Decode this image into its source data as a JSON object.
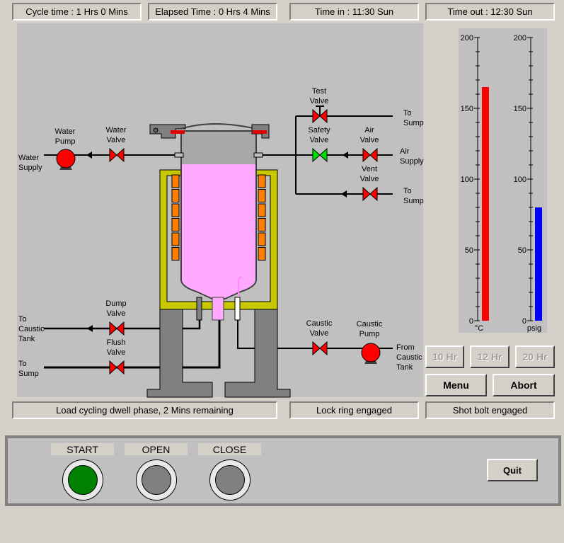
{
  "header": {
    "cycle_time": "Cycle time : 1 Hrs 0 Mins",
    "elapsed_time": "Elapsed Time : 0 Hrs 4 Mins",
    "time_in": "Time in : 11:30 Sun",
    "time_out": "Time out : 12:30 Sun"
  },
  "diagram": {
    "labels": {
      "water_supply": [
        "Water",
        "Supply"
      ],
      "water_pump": [
        "Water",
        "Pump"
      ],
      "to_sump_top": [
        "To",
        "Sump"
      ],
      "air_supply": [
        "Air",
        "Supply"
      ],
      "to_sump_mid": [
        "To",
        "Sump"
      ],
      "to_caustic_tank": [
        "To",
        "Caustic",
        "Tank"
      ],
      "to_sump_bottom": [
        "To",
        "Sump"
      ],
      "caustic_pump": [
        "Caustic",
        "Pump"
      ],
      "from_caustic_tank": [
        "From",
        "Caustic",
        "Tank"
      ]
    },
    "valves": [
      {
        "id": "water-valve",
        "label": [
          "Water",
          "Valve"
        ],
        "state": "closed"
      },
      {
        "id": "test-valve",
        "label": [
          "Test",
          "Valve"
        ],
        "state": "closed"
      },
      {
        "id": "safety-valve",
        "label": [
          "Safety",
          "Valve"
        ],
        "state": "open"
      },
      {
        "id": "air-valve",
        "label": [
          "Air",
          "Valve"
        ],
        "state": "closed"
      },
      {
        "id": "vent-valve",
        "label": [
          "Vent",
          "Valve"
        ],
        "state": "closed"
      },
      {
        "id": "dump-valve",
        "label": [
          "Dump",
          "Valve"
        ],
        "state": "closed"
      },
      {
        "id": "flush-valve",
        "label": [
          "Flush",
          "Valve"
        ],
        "state": "closed"
      },
      {
        "id": "caustic-valve",
        "label": [
          "Caustic",
          "Valve"
        ],
        "state": "closed"
      }
    ],
    "colors": {
      "closed": "#ff0000",
      "open": "#00e000",
      "pump": "#ff0000",
      "fluid": "#ffaaff",
      "jacket": "#c8c800",
      "heater": "#ff8000"
    }
  },
  "gauges": [
    {
      "id": "temperature",
      "unit": "°C",
      "value": 165,
      "max": 200,
      "ticks": [
        "200",
        "150",
        "100",
        "50",
        "0"
      ],
      "color": "#ff0000"
    },
    {
      "id": "pressure",
      "unit": "psig",
      "value": 80,
      "max": 200,
      "ticks": [
        "200",
        "150",
        "100",
        "50",
        "0"
      ],
      "color": "#0000ff"
    }
  ],
  "controls": {
    "hr10": "10 Hr",
    "hr12": "12 Hr",
    "hr20": "20 Hr",
    "menu": "Menu",
    "abort": "Abort"
  },
  "status": {
    "phase": "Load cycling dwell phase, 2 Mins remaining",
    "lock_ring": "Lock ring engaged",
    "shot_bolt": "Shot bolt engaged"
  },
  "bottom": {
    "start": "START",
    "open": "OPEN",
    "close": "CLOSE",
    "quit": "Quit",
    "lamp_colors": {
      "start": "#008000",
      "open": "#808080",
      "close": "#808080"
    }
  }
}
